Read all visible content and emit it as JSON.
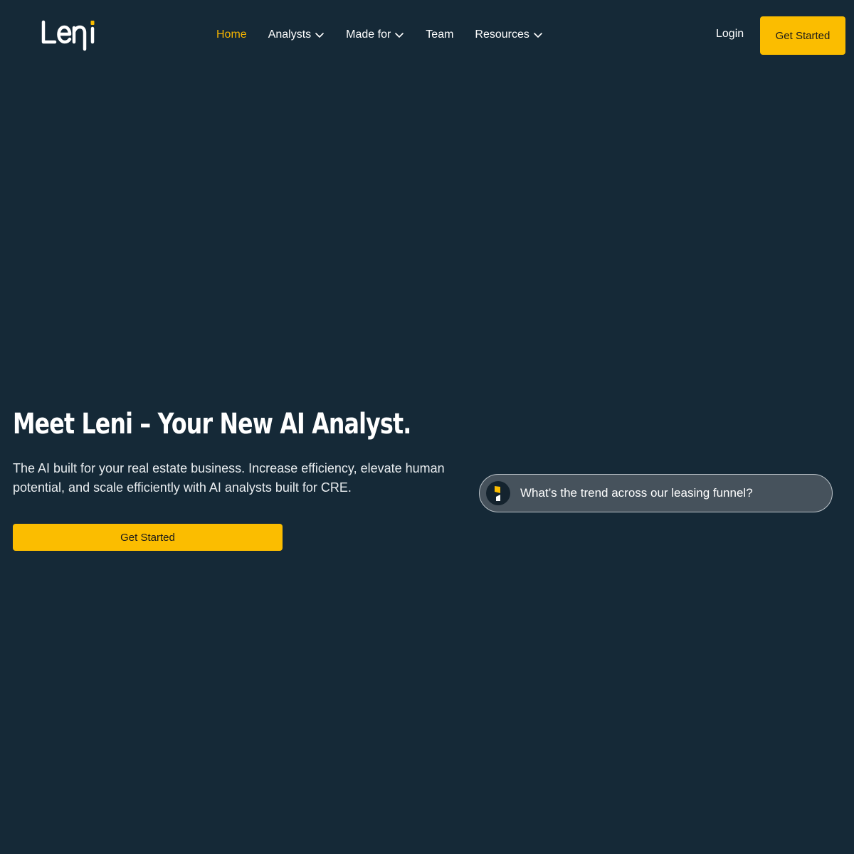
{
  "brand": {
    "logo_text": "Leni",
    "accent_color": "#fbbd00",
    "background_color": "#152937"
  },
  "nav": {
    "items": [
      {
        "label": "Home",
        "active": true,
        "has_dropdown": false
      },
      {
        "label": "Analysts",
        "active": false,
        "has_dropdown": true,
        "icon": "chevron-down-icon"
      },
      {
        "label": "Made for",
        "active": false,
        "has_dropdown": true,
        "icon": "chevron-down-icon"
      },
      {
        "label": "Team",
        "active": false,
        "has_dropdown": false
      },
      {
        "label": "Resources",
        "active": false,
        "has_dropdown": true,
        "icon": "chevron-down-icon"
      }
    ],
    "login_label": "Login",
    "cta_label": "Get Started"
  },
  "hero": {
    "title": "Meet Leni – Your New AI Analyst.",
    "subtitle": "The AI built for your real estate business. Increase efficiency, elevate human potential, and scale efficiently with AI analysts built for CRE.",
    "cta_label": "Get Started",
    "chat_prompt": "What’s the trend across our leasing funnel?",
    "chat_avatar_icon": "leni-assistant-icon"
  }
}
